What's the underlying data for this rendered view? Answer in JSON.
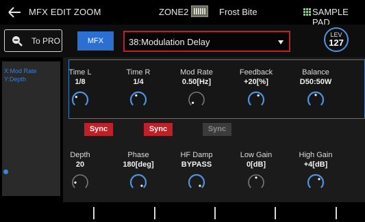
{
  "header": {
    "title": "MFX EDIT ZOOM",
    "zone": "ZONE2",
    "tone_name": "Frost Bite",
    "pad_label": "SAMPLE PAD"
  },
  "toolbar": {
    "to_pro_label": "To PRO",
    "mfx_label": "MFX",
    "mfx_type": "38:Modulation Delay",
    "level_label": "LEV",
    "level_value": "127"
  },
  "pad": {
    "x_label": "X:Mod Rate",
    "y_label": "Y:Depth"
  },
  "row1": [
    {
      "name": "Time L",
      "value": "1/8",
      "knob_fraction": 0.3,
      "highlight": true
    },
    {
      "name": "Time R",
      "value": "1/4",
      "knob_fraction": 0.4,
      "highlight": true
    },
    {
      "name": "Mod Rate",
      "value": "0.50[Hz]",
      "knob_fraction": 0.02,
      "highlight": false
    },
    {
      "name": "Feedback",
      "value": "+20[%]",
      "knob_fraction": 0.6,
      "highlight": true
    },
    {
      "name": "Balance",
      "value": "D50:50W",
      "knob_fraction": 0.5,
      "highlight": true
    }
  ],
  "sync": [
    {
      "label": "Sync",
      "state": "on"
    },
    {
      "label": "Sync",
      "state": "on"
    },
    {
      "label": "Sync",
      "state": "off"
    }
  ],
  "row2": [
    {
      "name": "Depth",
      "value": "20",
      "knob_fraction": 0.16,
      "highlight": false
    },
    {
      "name": "Phase",
      "value": "180[deg]",
      "knob_fraction": 1.0,
      "highlight": true
    },
    {
      "name": "HF Damp",
      "value": "BYPASS",
      "knob_fraction": 1.0,
      "highlight": true
    },
    {
      "name": "Low Gain",
      "value": "0[dB]",
      "knob_fraction": 0.5,
      "highlight": false
    },
    {
      "name": "High Gain",
      "value": "+4[dB]",
      "knob_fraction": 0.67,
      "highlight": true
    }
  ],
  "colors": {
    "accent_blue": "#4d95e0",
    "sync_red": "#c0202a",
    "mfx_blue": "#2a6fd1",
    "grid_green": "#7fd07f",
    "dim_grey": "#7a7a7a"
  }
}
